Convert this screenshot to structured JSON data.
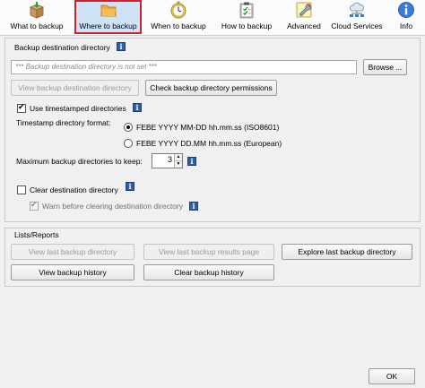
{
  "toolbar": {
    "items": [
      {
        "label": "What to backup",
        "icon": "box-icon"
      },
      {
        "label": "Where to backup",
        "icon": "folder-icon"
      },
      {
        "label": "When to backup",
        "icon": "stopwatch-icon"
      },
      {
        "label": "How to backup",
        "icon": "clipboard-icon"
      },
      {
        "label": "Advanced",
        "icon": "wrench-icon"
      },
      {
        "label": "Cloud Services",
        "icon": "cloud-network-icon"
      },
      {
        "label": "Info",
        "icon": "info-icon"
      }
    ]
  },
  "destination": {
    "heading": "Backup destination directory",
    "placeholder": "*** Backup destination directory is not set ***",
    "browse_label": "Browse ...",
    "view_label": "View backup destination directory",
    "check_label": "Check backup directory permissions",
    "use_timestamped_label": "Use timestamped directories",
    "timestamp_format_label": "Timestamp directory format:",
    "format_iso": "FEBE YYYY MM-DD hh.mm.ss (ISO8601)",
    "format_european": "FEBE YYYY DD.MM hh.mm.ss (European)",
    "max_dirs_label": "Maximum backup directories to keep:",
    "max_dirs_value": "3",
    "clear_label": "Clear destination directory",
    "warn_label": "Warn before clearing destination directory"
  },
  "lists": {
    "heading": "Lists/Reports",
    "view_last_dir": "View last backup directory",
    "view_last_results": "View last backup results page",
    "explore_last_dir": "Explore last backup directory",
    "view_history": "View backup history",
    "clear_history": "Clear backup history"
  },
  "footer": {
    "ok_label": "OK"
  },
  "colors": {
    "active_border": "#d0202c",
    "active_bg": "#cfe3f7",
    "info_blue": "#2c5fa8"
  }
}
